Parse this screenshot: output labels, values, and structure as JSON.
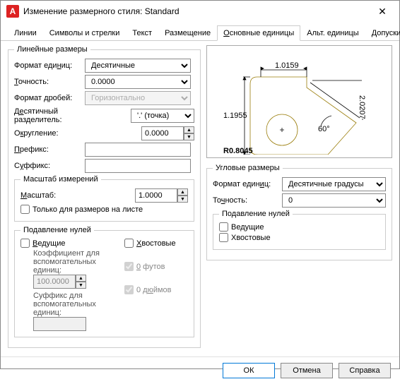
{
  "window": {
    "title": "Изменение размерного стиля: Standard"
  },
  "tabs": [
    "Линии",
    "Символы и стрелки",
    "Текст",
    "Размещение",
    "Основные единицы",
    "Альт. единицы",
    "Допуски"
  ],
  "active_tab": 4,
  "linear": {
    "legend": "Линейные размеры",
    "unit_format_label": "Формат единиц:",
    "unit_format": "Десятичные",
    "precision_label": "Точность:",
    "precision": "0.0000",
    "fraction_label": "Формат дробей:",
    "fraction": "Горизонтально",
    "decimal_sep_label": "Десятичный разделитель:",
    "decimal_sep": "'.' (точка)",
    "round_label": "Округление:",
    "round": "0.0000",
    "prefix_label": "Префикс:",
    "prefix": "",
    "suffix_label": "Суффикс:",
    "suffix": ""
  },
  "scale": {
    "legend": "Масштаб измерений",
    "scale_label": "Масштаб:",
    "scale": "1.0000",
    "layout_only": "Только для размеров на листе"
  },
  "zero": {
    "legend": "Подавление нулей",
    "leading": "Ведущие",
    "trailing": "Хвостовые",
    "subunit_factor_label": "Коэффициент для вспомогательных единиц:",
    "subunit_factor": "100.0000",
    "feet": "0 футов",
    "subunit_suffix_label": "Суффикс для вспомогательных единиц:",
    "subunit_suffix": "",
    "inches": "0 дюймов"
  },
  "angular": {
    "legend": "Угловые размеры",
    "format_label": "Формат единиц:",
    "format": "Десятичные градусы",
    "precision_label": "Точность:",
    "precision": "0",
    "zero_legend": "Подавление нулей",
    "leading": "Ведущие",
    "trailing": "Хвостовые"
  },
  "preview": {
    "d1": "1.0159",
    "d2": "1.1955",
    "d3": "2.0207",
    "r": "R0.8045",
    "ang": "60°"
  },
  "buttons": {
    "ok": "ОК",
    "cancel": "Отмена",
    "help": "Справка"
  }
}
